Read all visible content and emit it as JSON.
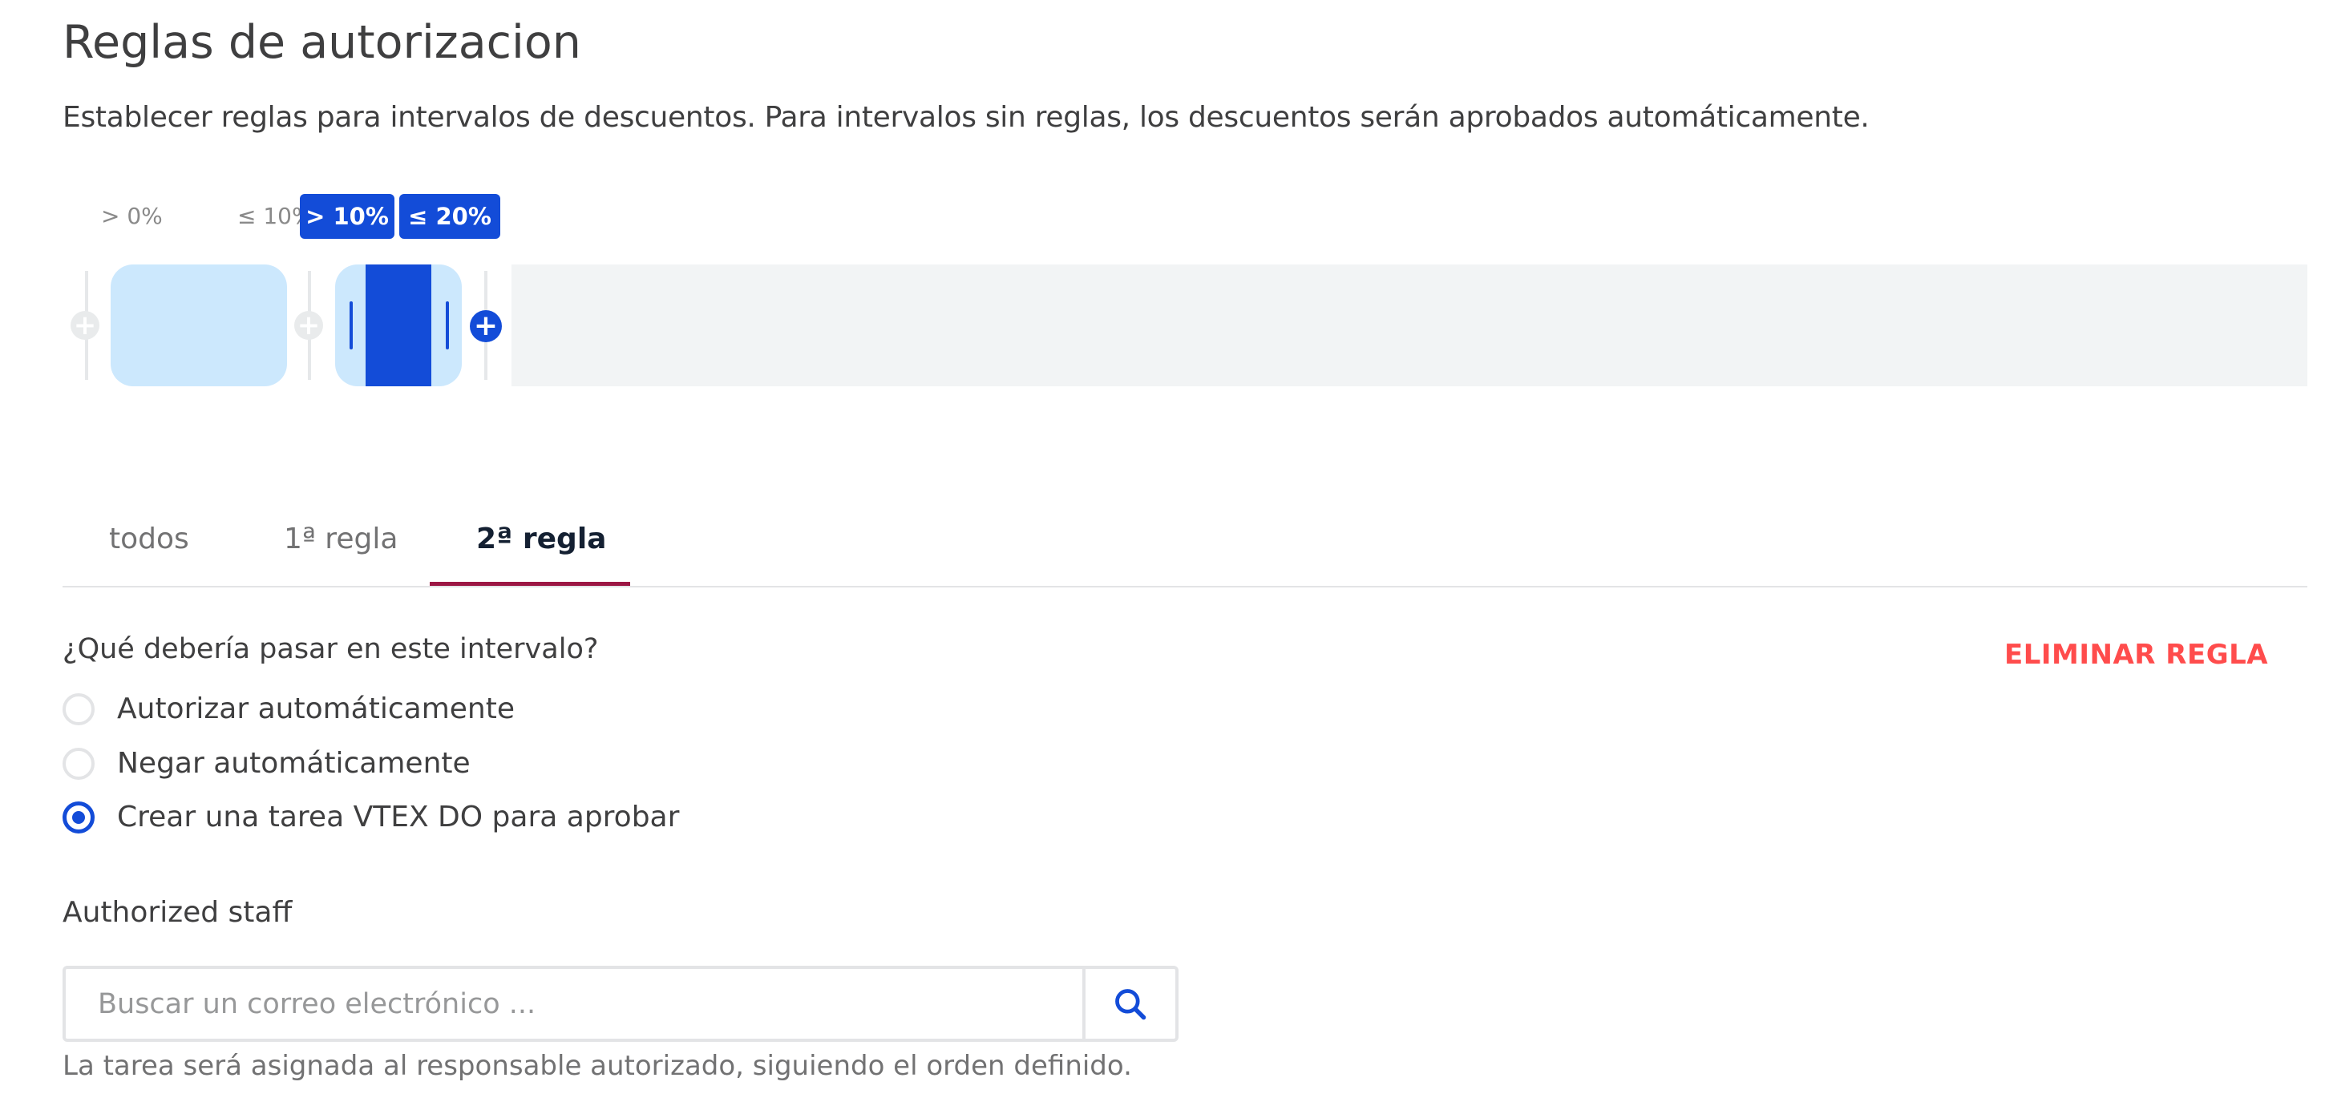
{
  "page": {
    "title": "Reglas de autorizacion",
    "description": "Establecer reglas para intervalos de descuentos. Para intervalos sin reglas, los descuentos serán aprobados automáticamente."
  },
  "range": {
    "labels": [
      {
        "text": "> 0%",
        "active": false
      },
      {
        "text": "≤ 10%",
        "active": false
      },
      {
        "text": "> 10%",
        "active": true
      },
      {
        "text": "≤ 20%",
        "active": true
      }
    ]
  },
  "tabs": [
    {
      "label": "todos",
      "active": false
    },
    {
      "label": "1ª regla",
      "active": false
    },
    {
      "label": "2ª regla",
      "active": true
    }
  ],
  "rule": {
    "question": "¿Qué debería pasar en este intervalo?",
    "delete_label": "ELIMINAR REGLA",
    "options": [
      {
        "label": "Autorizar automáticamente",
        "checked": false
      },
      {
        "label": "Negar automáticamente",
        "checked": false
      },
      {
        "label": "Crear una tarea VTEX DO para aprobar",
        "checked": true
      }
    ]
  },
  "staff": {
    "label": "Authorized staff",
    "search_placeholder": "Buscar un correo electrónico ...",
    "search_value": "",
    "hint": "La tarea será asignada al responsable autorizado, siguiendo el orden definido."
  },
  "icons": {
    "add": "plus-circle-icon",
    "search": "search-icon"
  },
  "colors": {
    "accent": "#134cd8",
    "light_segment": "#cce8fd",
    "danger": "#ff4c4c",
    "tab_underline": "#9c1744"
  }
}
